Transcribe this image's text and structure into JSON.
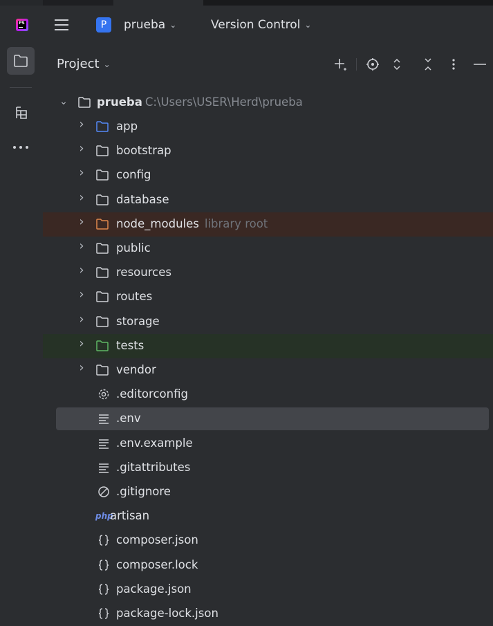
{
  "titlebar": {
    "project_initial": "P",
    "project_name": "prueba",
    "vcs_label": "Version Control"
  },
  "panel": {
    "title": "Project"
  },
  "tree": {
    "root": {
      "name": "prueba",
      "path": "C:\\Users\\USER\\Herd\\prueba"
    },
    "items": [
      {
        "type": "folder",
        "label": "app",
        "expandable": true,
        "folder_color": "#548af7"
      },
      {
        "type": "folder",
        "label": "bootstrap",
        "expandable": true
      },
      {
        "type": "folder",
        "label": "config",
        "expandable": true
      },
      {
        "type": "folder",
        "label": "database",
        "expandable": true
      },
      {
        "type": "folder",
        "label": "node_modules",
        "hint": "library root",
        "expandable": true,
        "folder_color": "#e0884c",
        "row_bg": "#3a2823"
      },
      {
        "type": "folder",
        "label": "public",
        "expandable": true
      },
      {
        "type": "folder",
        "label": "resources",
        "expandable": true
      },
      {
        "type": "folder",
        "label": "routes",
        "expandable": true
      },
      {
        "type": "folder",
        "label": "storage",
        "expandable": true
      },
      {
        "type": "folder",
        "label": "tests",
        "expandable": true,
        "folder_color": "#5fb865",
        "row_bg": "#263226"
      },
      {
        "type": "folder",
        "label": "vendor",
        "expandable": true
      },
      {
        "type": "file",
        "icon": "gear-icon",
        "label": ".editorconfig"
      },
      {
        "type": "file",
        "icon": "text-file-icon",
        "label": ".env",
        "selected": true
      },
      {
        "type": "file",
        "icon": "text-file-icon",
        "label": ".env.example"
      },
      {
        "type": "file",
        "icon": "text-file-icon",
        "label": ".gitattributes"
      },
      {
        "type": "file",
        "icon": "ignore-icon",
        "label": ".gitignore"
      },
      {
        "type": "file",
        "icon": "php-icon",
        "icon_text": "php",
        "label": "artisan"
      },
      {
        "type": "file",
        "icon": "json-icon",
        "label": "composer.json"
      },
      {
        "type": "file",
        "icon": "json-icon",
        "label": "composer.lock"
      },
      {
        "type": "file",
        "icon": "json-icon",
        "label": "package.json"
      },
      {
        "type": "file",
        "icon": "json-icon",
        "label": "package-lock.json"
      }
    ]
  },
  "colors": {
    "background": "#2b2d30",
    "selection": "#43454a",
    "accent": "#3574f0",
    "text": "#dfe1e5",
    "muted": "#868a91",
    "hint": "#6f737a"
  }
}
